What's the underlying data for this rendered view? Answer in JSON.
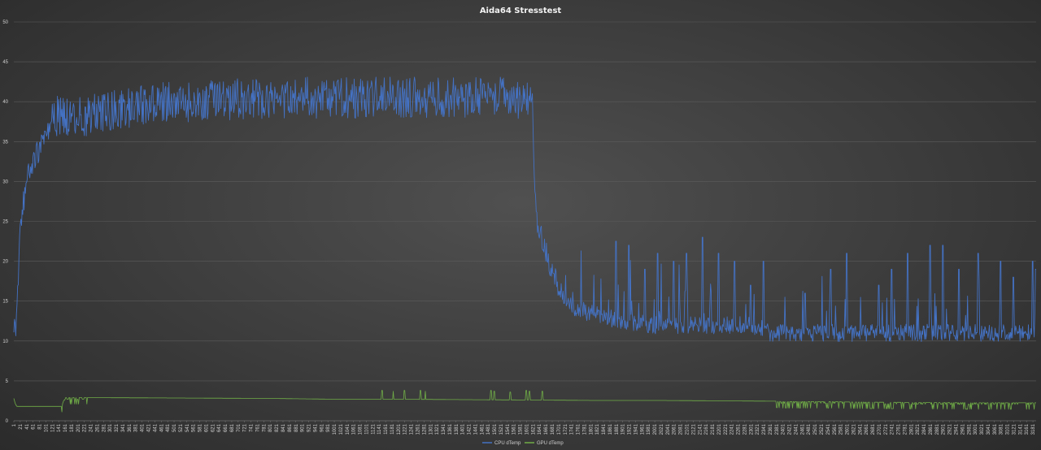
{
  "chart_data": {
    "type": "line",
    "title": "Aida64 Stresstest",
    "xlabel": "",
    "ylabel": "",
    "ylim": [
      0,
      50
    ],
    "yticks": [
      0,
      5,
      10,
      15,
      20,
      25,
      30,
      35,
      40,
      45,
      50
    ],
    "xlim": [
      1,
      3191
    ],
    "xtick_start": 1,
    "xtick_step": 20,
    "xtick_end": 3181,
    "grid": true,
    "legend_position": "bottom",
    "series": [
      {
        "name": "CPU dTemp",
        "color": "#4472c4",
        "keypoints": [
          [
            1,
            11
          ],
          [
            10,
            12
          ],
          [
            20,
            24
          ],
          [
            40,
            30
          ],
          [
            60,
            32.5
          ],
          [
            80,
            34
          ],
          [
            100,
            36
          ],
          [
            120,
            37.5
          ],
          [
            140,
            38.5
          ],
          [
            170,
            38
          ],
          [
            200,
            38
          ],
          [
            250,
            38.5
          ],
          [
            300,
            39
          ],
          [
            350,
            39
          ],
          [
            400,
            39.5
          ],
          [
            450,
            40
          ],
          [
            500,
            40
          ],
          [
            550,
            40
          ],
          [
            600,
            40
          ],
          [
            700,
            40.3
          ],
          [
            800,
            40.5
          ],
          [
            900,
            40.5
          ],
          [
            1000,
            40.5
          ],
          [
            1100,
            40.5
          ],
          [
            1200,
            40.5
          ],
          [
            1300,
            40.5
          ],
          [
            1400,
            40.5
          ],
          [
            1500,
            40.5
          ],
          [
            1600,
            40.5
          ],
          [
            1619,
            40.5
          ],
          [
            1622,
            37
          ],
          [
            1625,
            30
          ],
          [
            1630,
            26
          ],
          [
            1640,
            24
          ],
          [
            1660,
            21
          ],
          [
            1680,
            19
          ],
          [
            1700,
            17
          ],
          [
            1720,
            15.5
          ],
          [
            1740,
            14.5
          ],
          [
            1760,
            14
          ],
          [
            1800,
            13.5
          ],
          [
            1850,
            13
          ],
          [
            1900,
            12.5
          ],
          [
            2000,
            12
          ],
          [
            2100,
            12
          ],
          [
            2200,
            12
          ],
          [
            2300,
            12
          ],
          [
            2350,
            11.5
          ],
          [
            2360,
            11
          ],
          [
            2500,
            11
          ],
          [
            2700,
            11
          ],
          [
            2900,
            11
          ],
          [
            3100,
            11
          ],
          [
            3191,
            11
          ]
        ],
        "spikes": [
          [
            1880,
            22.5
          ],
          [
            1920,
            22
          ],
          [
            1970,
            19
          ],
          [
            2010,
            21
          ],
          [
            2060,
            20
          ],
          [
            2100,
            21
          ],
          [
            2150,
            23
          ],
          [
            2200,
            21
          ],
          [
            2250,
            20
          ],
          [
            2300,
            17
          ],
          [
            2340,
            20
          ],
          [
            2470,
            16
          ],
          [
            2550,
            19
          ],
          [
            2600,
            21
          ],
          [
            2700,
            17
          ],
          [
            2740,
            19
          ],
          [
            2790,
            21
          ],
          [
            2860,
            22
          ],
          [
            2900,
            22
          ],
          [
            2950,
            19
          ],
          [
            3010,
            21
          ],
          [
            3080,
            20
          ],
          [
            3120,
            18
          ],
          [
            3180,
            20
          ],
          [
            3190,
            19
          ]
        ]
      },
      {
        "name": "GPU dTemp",
        "color": "#70ad47",
        "keypoints": [
          [
            1,
            2.8
          ],
          [
            5,
            2.2
          ],
          [
            10,
            1.8
          ],
          [
            150,
            1.8
          ],
          [
            160,
            2.9
          ],
          [
            200,
            2.9
          ],
          [
            230,
            2.9
          ],
          [
            800,
            2.8
          ],
          [
            1000,
            2.7
          ],
          [
            1200,
            2.7
          ],
          [
            1400,
            2.65
          ],
          [
            1620,
            2.6
          ],
          [
            1800,
            2.55
          ],
          [
            2000,
            2.55
          ],
          [
            2200,
            2.5
          ],
          [
            2380,
            2.45
          ],
          [
            2400,
            2.4
          ],
          [
            2550,
            2.4
          ],
          [
            2600,
            2.35
          ],
          [
            2800,
            2.3
          ],
          [
            3000,
            2.25
          ],
          [
            3191,
            2.25
          ]
        ],
        "spikes": [
          [
            1150,
            3.8
          ],
          [
            1185,
            3.7
          ],
          [
            1220,
            3.8
          ],
          [
            1270,
            3.8
          ],
          [
            1285,
            3.7
          ],
          [
            1490,
            3.8
          ],
          [
            1500,
            3.7
          ],
          [
            1550,
            3.6
          ],
          [
            1600,
            3.8
          ],
          [
            1610,
            3.7
          ],
          [
            1650,
            3.7
          ]
        ]
      }
    ]
  }
}
